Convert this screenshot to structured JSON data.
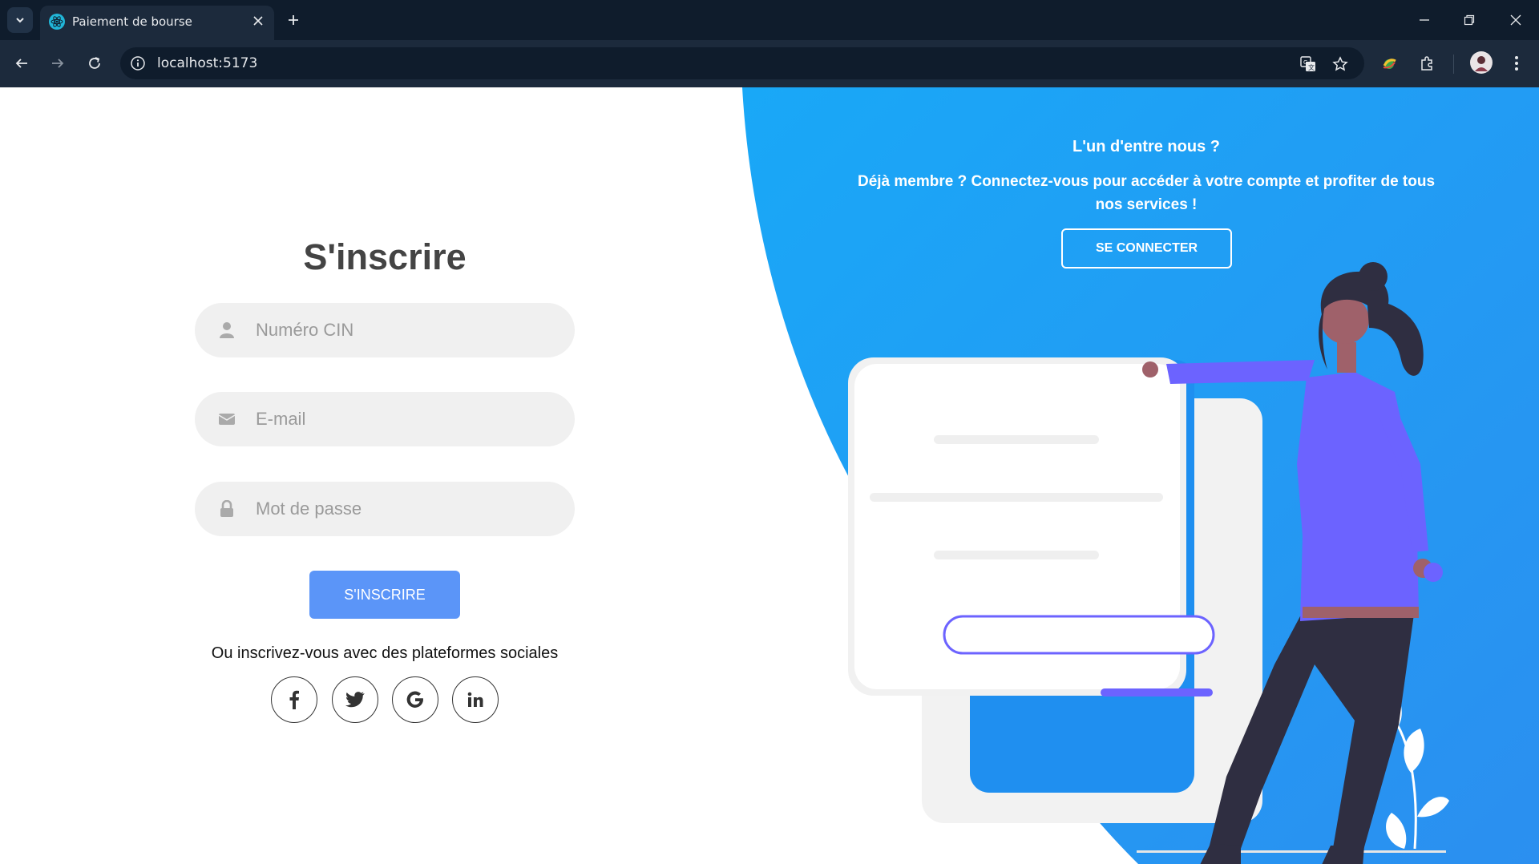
{
  "browser": {
    "tab_title": "Paiement de bourse",
    "url": "localhost:5173"
  },
  "signup": {
    "title": "S'inscrire",
    "fields": [
      {
        "placeholder": "Numéro CIN",
        "icon": "user-icon"
      },
      {
        "placeholder": "E-mail",
        "icon": "envelope-icon"
      },
      {
        "placeholder": "Mot de passe",
        "icon": "lock-icon"
      }
    ],
    "submit_label": "S'inscrire",
    "social_text": "Ou inscrivez-vous avec des plateformes sociales",
    "social_icons": [
      "facebook-icon",
      "twitter-icon",
      "google-icon",
      "linkedin-icon"
    ]
  },
  "panel": {
    "title": "L'un d'entre nous ?",
    "text": "Déjà membre ? Connectez-vous pour accéder à votre compte et profiter de tous nos services !",
    "login_label": "SE CONNECTER"
  },
  "colors": {
    "accent_blue": "#5b95f8",
    "panel_blue": "#1ea3f5",
    "illustration_purple": "#6c63ff",
    "chrome_dark": "#0f1c2c"
  }
}
